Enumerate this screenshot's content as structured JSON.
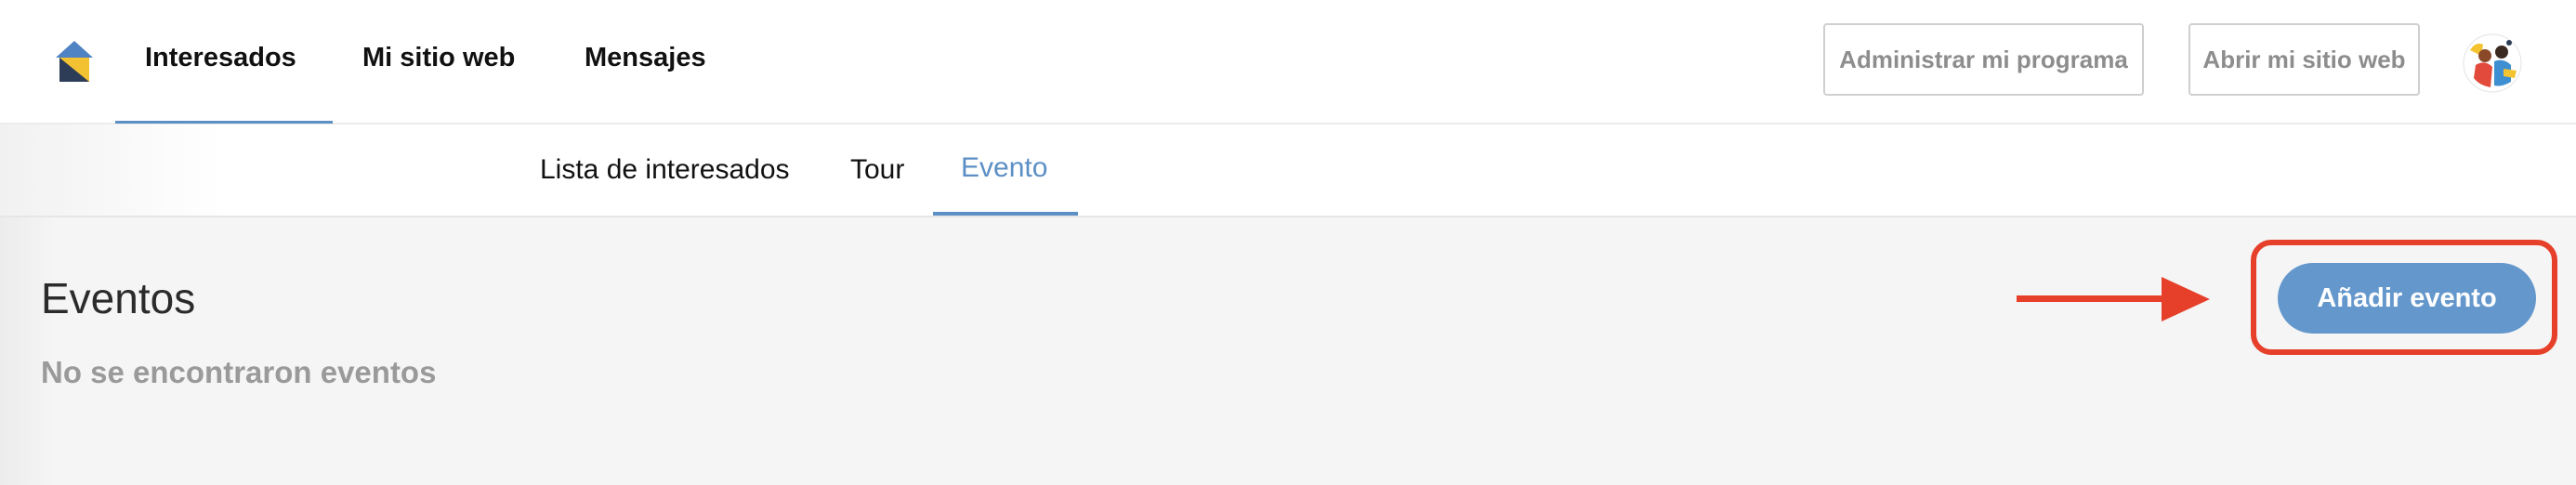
{
  "header": {
    "nav": [
      {
        "label": "Interesados",
        "active": true
      },
      {
        "label": "Mi sitio web",
        "active": false
      },
      {
        "label": "Mensajes",
        "active": false
      }
    ],
    "actions": {
      "manage_label": "Administrar mi programa",
      "open_site_label": "Abrir mi sitio web"
    },
    "avatar_icon": "avatar-icon",
    "logo_icon": "house-logo-icon"
  },
  "subtabs": [
    {
      "label": "Lista de interesados",
      "active": false
    },
    {
      "label": "Tour",
      "active": false
    },
    {
      "label": "Evento",
      "active": true
    }
  ],
  "main": {
    "title": "Eventos",
    "empty_message": "No se encontraron eventos",
    "add_button_label": "Añadir evento"
  },
  "annotation": {
    "arrow_icon": "right-arrow-icon",
    "highlight_color": "#e6402b"
  },
  "colors": {
    "accent": "#5b8fc5",
    "primary_button": "#6497cc"
  }
}
